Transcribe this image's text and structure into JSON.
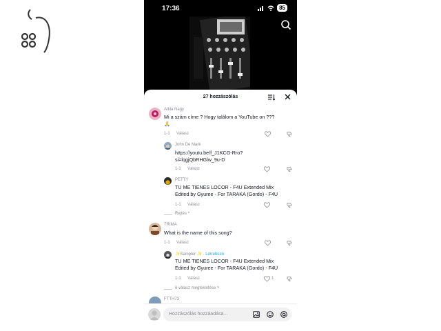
{
  "status": {
    "time": "17:36",
    "battery": "85"
  },
  "sheet": {
    "comment_count": "27 hozzászólás"
  },
  "comments": [
    {
      "user": "Attila Nagy",
      "text_line1": "Mi a szám címe ? Hogy találom a YouTube on ???",
      "text_line2": "🙏",
      "time": "1-1",
      "reply": "Válasz"
    },
    {
      "user": "John De Mark",
      "text_line1": "https://youtu.be/f_J1KCG-Rro?",
      "text_line2": "si=lqgjQbRHGlw_9u-D",
      "time": "1-1",
      "reply": "Válasz"
    },
    {
      "user": "PETTY",
      "text_line1": "TU ME TIENES LOCOR - F4U Extended Mix",
      "text_line2": "Edited by Gyuree - For TARAKA (Gordo) - F4U",
      "time": "1-1",
      "reply": "Válasz"
    },
    {
      "user": "TRIMA",
      "text_line1": "What is the name of this song?",
      "time": "1-1",
      "reply": "Válasz"
    },
    {
      "user": "✨Sampler ✨",
      "creator_tag": "· Létrehozó",
      "text_line1": "TU ME TIENES LOCOR - F4U Extended Mix",
      "text_line2": "Edited by Gyuree - For TARAKA (Gordo) - F4U",
      "time": "1-1",
      "reply": "Válasz",
      "likes": "1"
    },
    {
      "user": "FTTH73"
    }
  ],
  "collapse_label": "Rejtés ^",
  "expand_label": "6 válasz megtekintése ˅",
  "composer": {
    "placeholder": "Hozzászólás hozzáadása..."
  },
  "icons": [
    "search-icon",
    "sort-icon",
    "close-icon",
    "heart-icon",
    "dislike-icon",
    "image-icon",
    "emoji-icon",
    "mention-icon"
  ]
}
